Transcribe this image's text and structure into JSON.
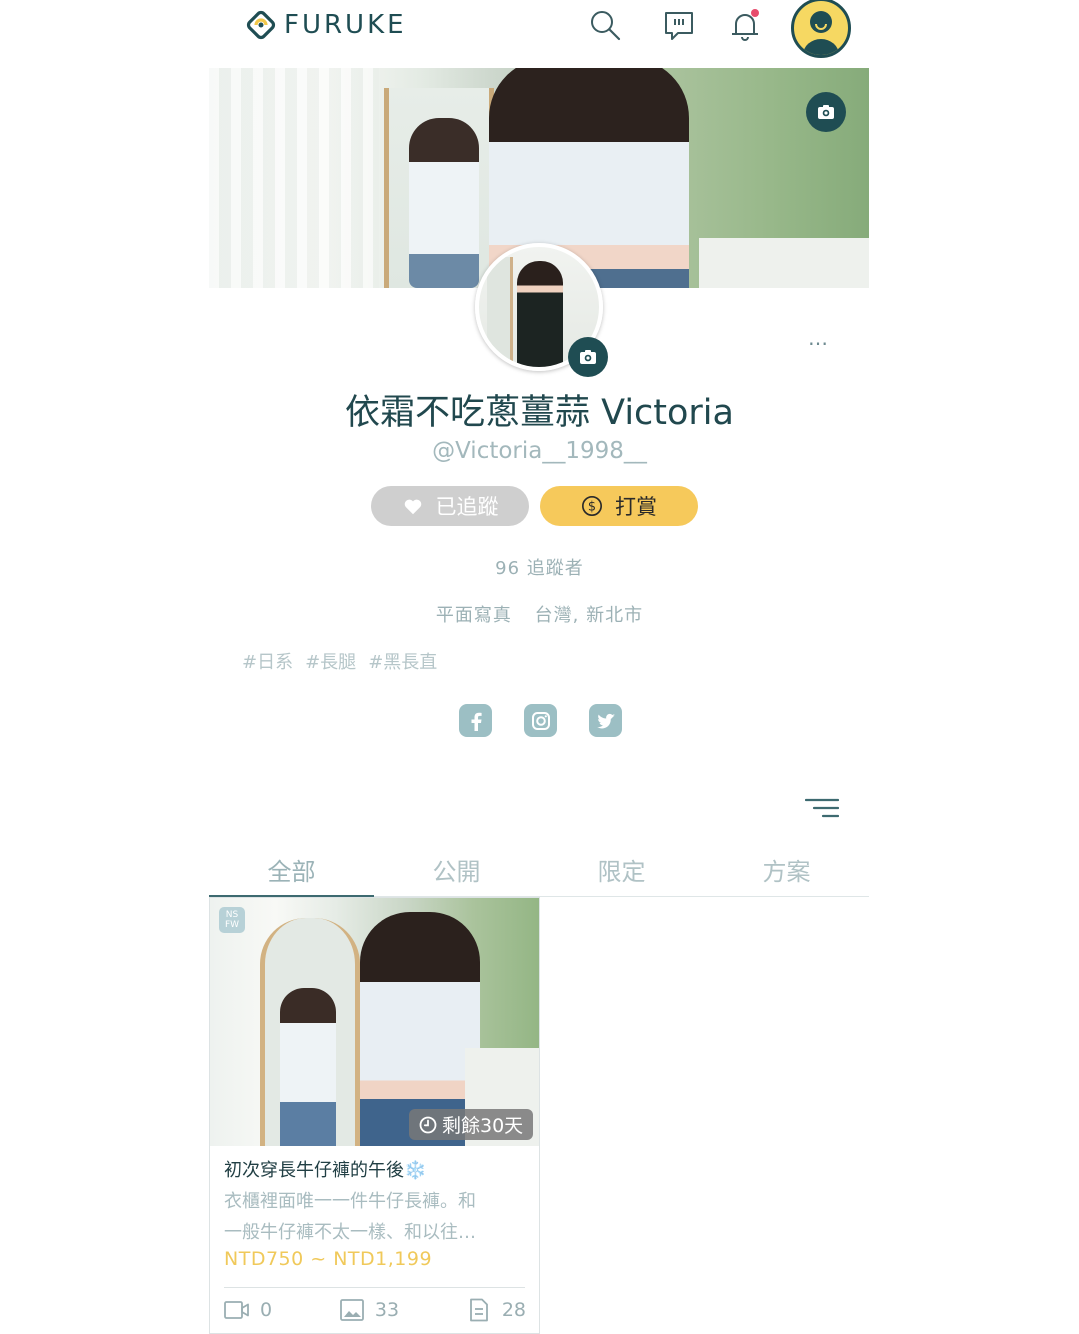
{
  "header": {
    "brand": "FURUKE",
    "colors": {
      "brand": "#1f4d53",
      "brand_accent": "#f2c84b"
    },
    "icons": [
      "search-icon",
      "message-icon",
      "bell-icon",
      "user-avatar-icon"
    ]
  },
  "profile": {
    "name": "依霜不吃蔥薑蒜 Victoria",
    "handle": "@Victoria__1998__",
    "more": "…",
    "follow_label": "已追蹤",
    "tip_label": "打賞",
    "followers": "96 追蹤者",
    "category": "平面寫真",
    "location": "台灣, 新北市",
    "tags": [
      "#日系",
      "#長腿",
      "#黑長直"
    ],
    "socials": [
      "facebook-icon",
      "instagram-icon",
      "twitter-icon"
    ],
    "colors": {
      "follow_bg": "#cfcfcf",
      "tip_bg": "#f6c95b"
    }
  },
  "tabs": [
    {
      "label": "全部",
      "active": true
    },
    {
      "label": "公開",
      "active": false
    },
    {
      "label": "限定",
      "active": false
    },
    {
      "label": "方案",
      "active": false
    }
  ],
  "post": {
    "badge_line1": "NS",
    "badge_line2": "FW",
    "remaining": "剩餘30天",
    "title": "初次穿長牛仔褲的午後",
    "title_emoji": "❄️",
    "desc_line1": "衣櫃裡面唯一一件牛仔長褲。和",
    "desc_line2": "一般牛仔褲不太一樣、和以往…",
    "price": "NTD750 ~ NTD1,199",
    "videos": "0",
    "images": "33",
    "docs": "28"
  }
}
